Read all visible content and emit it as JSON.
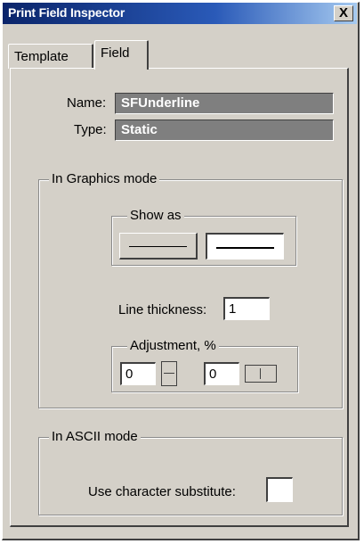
{
  "window": {
    "title": "Print Field Inspector",
    "close_glyph": "X"
  },
  "tabs": [
    {
      "label": "Template"
    },
    {
      "label": "Field"
    }
  ],
  "field": {
    "name_label": "Name:",
    "name_value": "SFUnderline",
    "type_label": "Type:",
    "type_value": "Static"
  },
  "graphics": {
    "group_label": "In Graphics mode",
    "show_as_label": "Show as",
    "line_thickness_label": "Line thickness:",
    "line_thickness_value": "1",
    "adjustment_label": "Adjustment, %",
    "adjust_vertical_value": "0",
    "adjust_horizontal_value": "0"
  },
  "ascii": {
    "group_label": "In ASCII mode",
    "substitute_label": "Use character substitute:",
    "substitute_value": ""
  }
}
